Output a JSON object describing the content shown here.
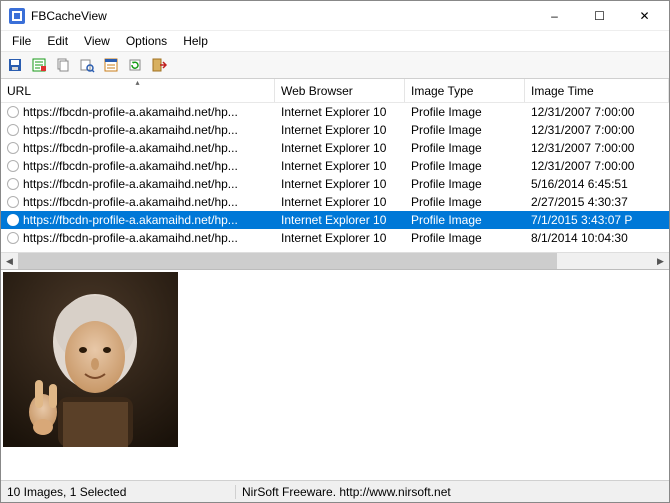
{
  "window": {
    "title": "FBCacheView",
    "controls": {
      "min": "–",
      "max": "☐",
      "close": "✕"
    }
  },
  "menu": [
    "File",
    "Edit",
    "View",
    "Options",
    "Help"
  ],
  "toolbar_icons": [
    "save-icon",
    "html-report-icon",
    "copy-icon",
    "find-icon",
    "properties-icon",
    "refresh-icon",
    "exit-icon"
  ],
  "columns": {
    "url": "URL",
    "browser": "Web Browser",
    "type": "Image Type",
    "time": "Image Time"
  },
  "rows": [
    {
      "url": "https://fbcdn-profile-a.akamaihd.net/hp...",
      "browser": "Internet Explorer 10",
      "type": "Profile Image",
      "time": "12/31/2007 7:00:00",
      "selected": false
    },
    {
      "url": "https://fbcdn-profile-a.akamaihd.net/hp...",
      "browser": "Internet Explorer 10",
      "type": "Profile Image",
      "time": "12/31/2007 7:00:00",
      "selected": false
    },
    {
      "url": "https://fbcdn-profile-a.akamaihd.net/hp...",
      "browser": "Internet Explorer 10",
      "type": "Profile Image",
      "time": "12/31/2007 7:00:00",
      "selected": false
    },
    {
      "url": "https://fbcdn-profile-a.akamaihd.net/hp...",
      "browser": "Internet Explorer 10",
      "type": "Profile Image",
      "time": "12/31/2007 7:00:00",
      "selected": false
    },
    {
      "url": "https://fbcdn-profile-a.akamaihd.net/hp...",
      "browser": "Internet Explorer 10",
      "type": "Profile Image",
      "time": "5/16/2014 6:45:51",
      "selected": false
    },
    {
      "url": "https://fbcdn-profile-a.akamaihd.net/hp...",
      "browser": "Internet Explorer 10",
      "type": "Profile Image",
      "time": "2/27/2015 4:30:37",
      "selected": false
    },
    {
      "url": "https://fbcdn-profile-a.akamaihd.net/hp...",
      "browser": "Internet Explorer 10",
      "type": "Profile Image",
      "time": "7/1/2015 3:43:07 P",
      "selected": true
    },
    {
      "url": "https://fbcdn-profile-a.akamaihd.net/hp...",
      "browser": "Internet Explorer 10",
      "type": "Profile Image",
      "time": "8/1/2014 10:04:30",
      "selected": false
    }
  ],
  "status": {
    "left": "10 Images, 1 Selected",
    "right": "NirSoft Freeware.  http://www.nirsoft.net"
  }
}
